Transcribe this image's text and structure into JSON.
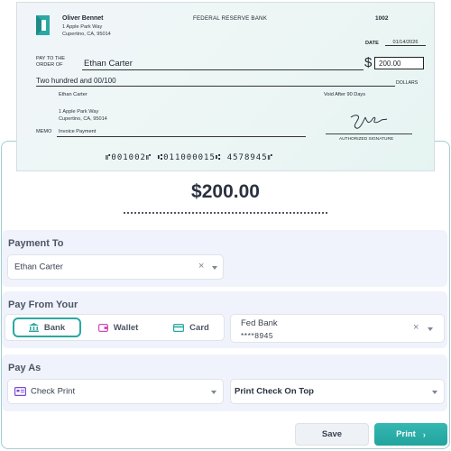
{
  "check": {
    "owner_name": "Oliver Bennet",
    "owner_address_line1": "1 Apple Park Way",
    "owner_address_line2": "Cupertino, CA, 95014",
    "bank_name": "FEDERAL RESERVE BANK",
    "check_number": "1002",
    "date_label": "DATE",
    "date_value": "01/14/2026",
    "pay_to_line1": "PAY TO THE",
    "pay_to_line2": "ORDER OF",
    "payee_name": "Ethan Carter",
    "dollar_sign": "$",
    "amount": "200.00",
    "amount_words": "Two hundred and 00/100",
    "dollars_label": "DOLLARS",
    "payee_small_name": "Ethan Carter",
    "payee_address_line1": "1 Apple Park Way",
    "payee_address_line2": "Cupertino, CA, 95014",
    "void_notice": "Void After 90 Days",
    "memo_label": "MEMO",
    "memo_value": "Invoice Payment",
    "signature_label": "AUTHORIZED SIGNATURE",
    "micr_line": "⑈001002⑈ ⑆011000015⑆ 4578945⑈"
  },
  "summary": {
    "amount_display": "$200.00"
  },
  "payment_to": {
    "title": "Payment To",
    "selected_payee": "Ethan Carter"
  },
  "pay_from": {
    "title": "Pay From Your",
    "tabs": [
      {
        "label": "Bank",
        "icon": "bank-icon",
        "active": true
      },
      {
        "label": "Wallet",
        "icon": "wallet-icon",
        "active": false
      },
      {
        "label": "Card",
        "icon": "card-icon",
        "active": false
      }
    ],
    "account_name": "Fed Bank",
    "account_number": "****8945"
  },
  "pay_as": {
    "title": "Pay As",
    "method": "Check Print",
    "print_option": "Print Check On Top"
  },
  "actions": {
    "save_label": "Save",
    "print_label": "Print"
  },
  "colors": {
    "accent": "#2aa8a3",
    "section_bg": "#f0f3fb",
    "wallet_icon": "#d04bb7",
    "card_icon": "#2aa8a3",
    "check_icon": "#7b4bd0"
  }
}
